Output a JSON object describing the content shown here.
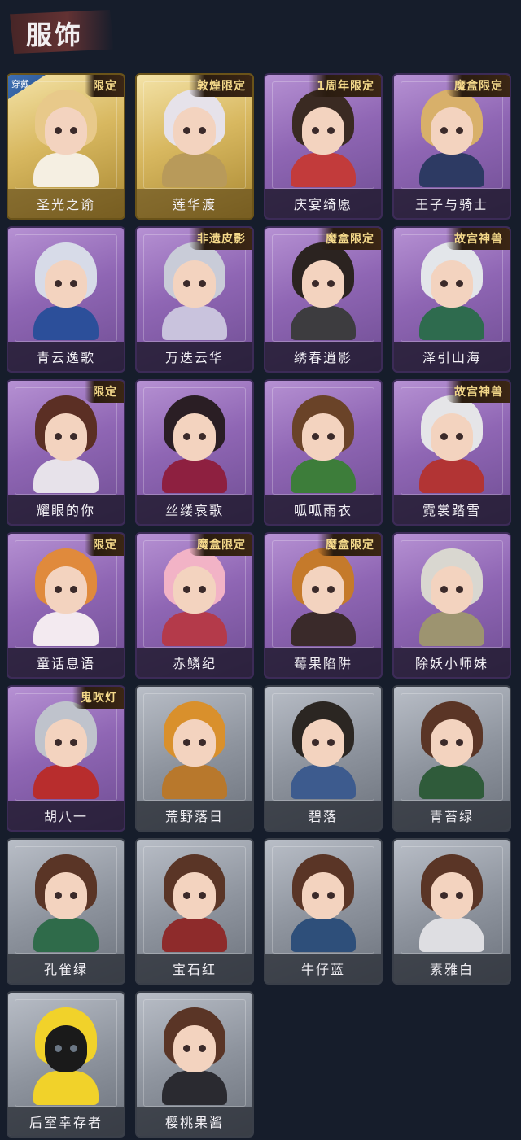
{
  "page": {
    "title": "服饰"
  },
  "colors": {
    "background": "#161d2b",
    "purple_card": "#8f66b4",
    "gold_card": "#d8b860",
    "gray_card": "#8e949e",
    "badge_text": "#f4d98a",
    "wear_tag": "#3e6fb3"
  },
  "costumes": [
    {
      "name": "圣光之谕",
      "badge": "限定",
      "wear": "穿戴",
      "style": "gold",
      "hair": "#e8c98a",
      "outfit": "#f5efe2"
    },
    {
      "name": "莲华渡",
      "badge": "敦煌限定",
      "style": "gold",
      "hair": "#e6e2ea",
      "outfit": "#b89a5a"
    },
    {
      "name": "庆宴绮愿",
      "badge": "1周年限定",
      "style": "purple",
      "hair": "#3a2a22",
      "outfit": "#c23b3b"
    },
    {
      "name": "王子与骑士",
      "badge": "魔盒限定",
      "style": "purple",
      "hair": "#d8b06a",
      "outfit": "#2d3a63"
    },
    {
      "name": "青云逸歌",
      "style": "purple",
      "hair": "#d7dbe8",
      "outfit": "#2c4f9a"
    },
    {
      "name": "万迭云华",
      "badge": "非遗皮影",
      "style": "purple",
      "hair": "#c9ccd8",
      "outfit": "#c9c3dd"
    },
    {
      "name": "绣春逍影",
      "badge": "魔盒限定",
      "style": "purple",
      "hair": "#2b2320",
      "outfit": "#3d3c3f"
    },
    {
      "name": "泽引山海",
      "badge": "故宫神兽",
      "style": "purple",
      "hair": "#e3e6ea",
      "outfit": "#2e6b4e"
    },
    {
      "name": "耀眼的你",
      "badge": "限定",
      "style": "purple",
      "hair": "#5b2f24",
      "outfit": "#e7e2ea"
    },
    {
      "name": "丝缕哀歌",
      "style": "purple",
      "hair": "#2a1e24",
      "outfit": "#8e2040"
    },
    {
      "name": "呱呱雨衣",
      "style": "purple",
      "hair": "#6a4328",
      "outfit": "#3d7d3a"
    },
    {
      "name": "霓裳踏雪",
      "badge": "故宫神兽",
      "style": "purple",
      "hair": "#e5e5e8",
      "outfit": "#b23434"
    },
    {
      "name": "童话息语",
      "badge": "限定",
      "style": "purple",
      "hair": "#e08a3c",
      "outfit": "#f3eaf0"
    },
    {
      "name": "赤鳞纪",
      "badge": "魔盒限定",
      "style": "purple",
      "hair": "#f2b3c6",
      "outfit": "#b43a4a"
    },
    {
      "name": "莓果陷阱",
      "badge": "魔盒限定",
      "style": "purple",
      "hair": "#c57a2b",
      "outfit": "#3a2a2a"
    },
    {
      "name": "除妖小师妹",
      "style": "purple",
      "hair": "#d9d7d0",
      "outfit": "#9d9470"
    },
    {
      "name": "胡八一",
      "badge": "鬼吹灯",
      "style": "purple",
      "hair": "#bfc3cc",
      "outfit": "#b82d2d"
    },
    {
      "name": "荒野落日",
      "style": "gray",
      "hair": "#d9902c",
      "outfit": "#b8782c"
    },
    {
      "name": "碧落",
      "style": "gray",
      "hair": "#2b2622",
      "outfit": "#3d5b8e"
    },
    {
      "name": "青苔绿",
      "style": "gray",
      "hair": "#5a3526",
      "outfit": "#2f5b3a"
    },
    {
      "name": "孔雀绿",
      "style": "gray",
      "hair": "#5a3526",
      "outfit": "#2f6b4a"
    },
    {
      "name": "宝石红",
      "style": "gray",
      "hair": "#5a3526",
      "outfit": "#8e2b2b"
    },
    {
      "name": "牛仔蓝",
      "style": "gray",
      "hair": "#5a3526",
      "outfit": "#2e4f7a"
    },
    {
      "name": "素雅白",
      "style": "gray",
      "hair": "#5a3526",
      "outfit": "#dedee2"
    },
    {
      "name": "后室幸存者",
      "style": "gray",
      "hair": "#f1d22a",
      "outfit": "#f1d22a",
      "icon": "gas-mask-icon"
    },
    {
      "name": "樱桃果酱",
      "style": "gray",
      "hair": "#5a3526",
      "outfit": "#2a2a30"
    }
  ]
}
